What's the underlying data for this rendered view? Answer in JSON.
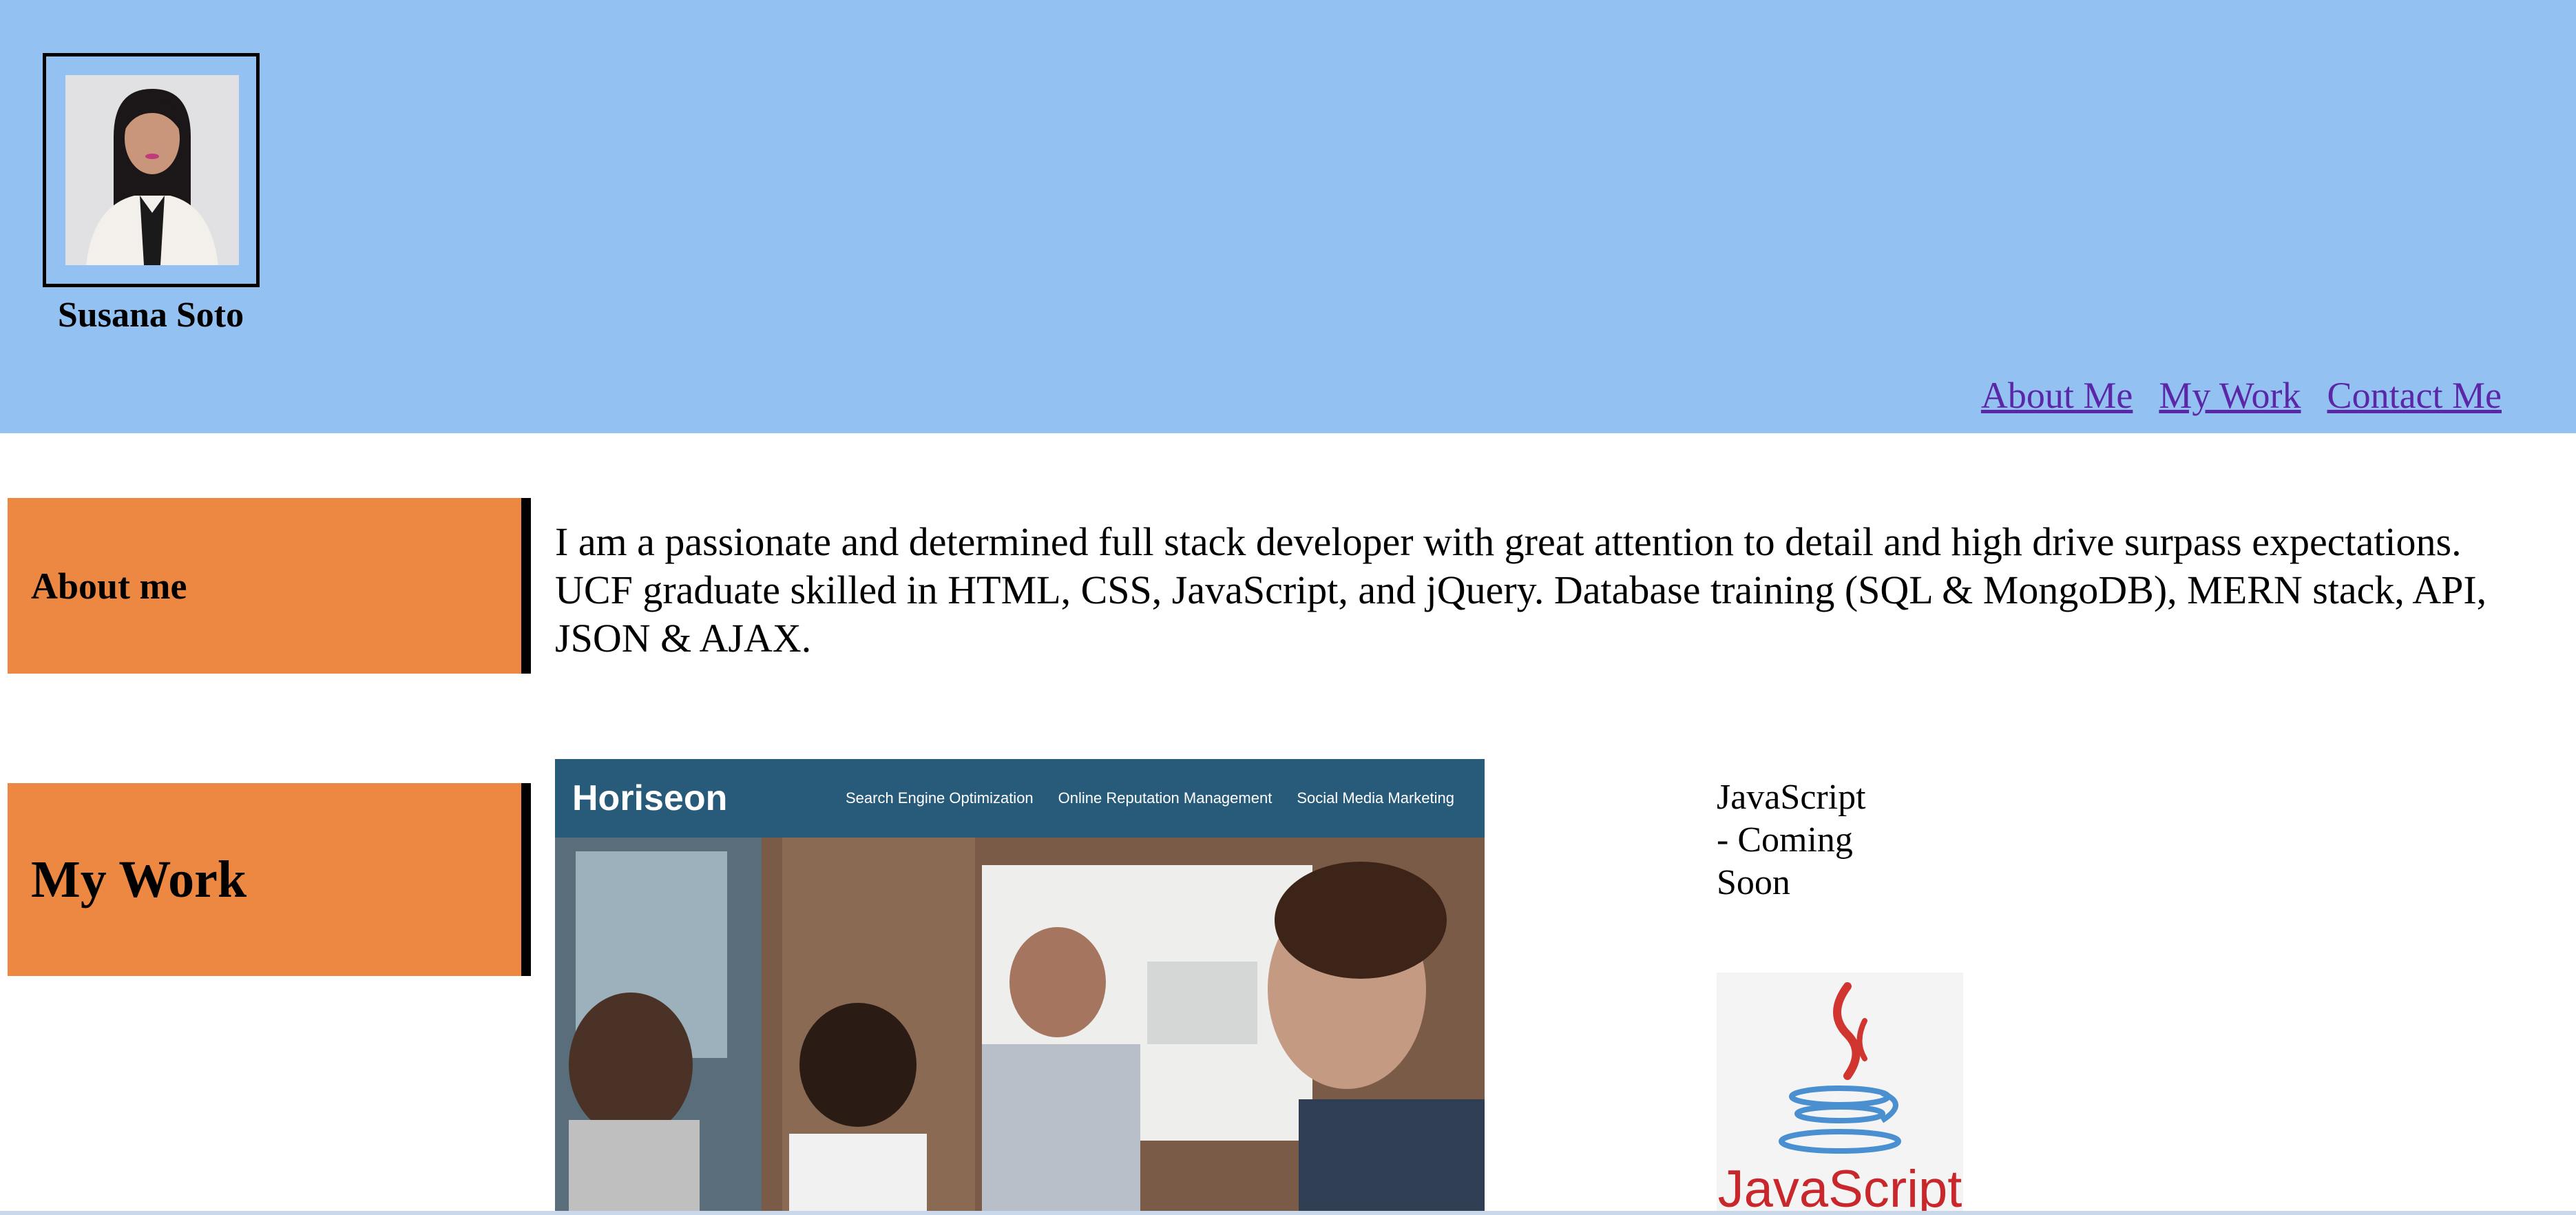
{
  "header": {
    "name": "Susana Soto",
    "background": "#92c1f2"
  },
  "nav": {
    "items": [
      {
        "label": "About Me"
      },
      {
        "label": "My Work"
      },
      {
        "label": "Contact Me"
      }
    ]
  },
  "about": {
    "title": "About me",
    "lines": [
      "I am a passionate and determined full stack developer with great attention to detail and high drive surpass expectations.",
      "UCF graduate skilled in HTML, CSS, JavaScript, and jQuery. Database training (SQL & MongoDB), MERN stack, API,",
      "JSON & AJAX."
    ]
  },
  "work": {
    "title": "My Work",
    "project": {
      "site_logo": "Horiseon",
      "site_nav": [
        "Search Engine Optimization",
        "Online Reputation Management",
        "Social Media Marketing"
      ]
    },
    "coming_soon": [
      "JavaScript",
      "- Coming",
      "Soon"
    ],
    "logo_text": "JavaScript"
  },
  "colors": {
    "tab": "#ed8843",
    "link": "#5b27a6",
    "site_nav": "#285b7a"
  }
}
